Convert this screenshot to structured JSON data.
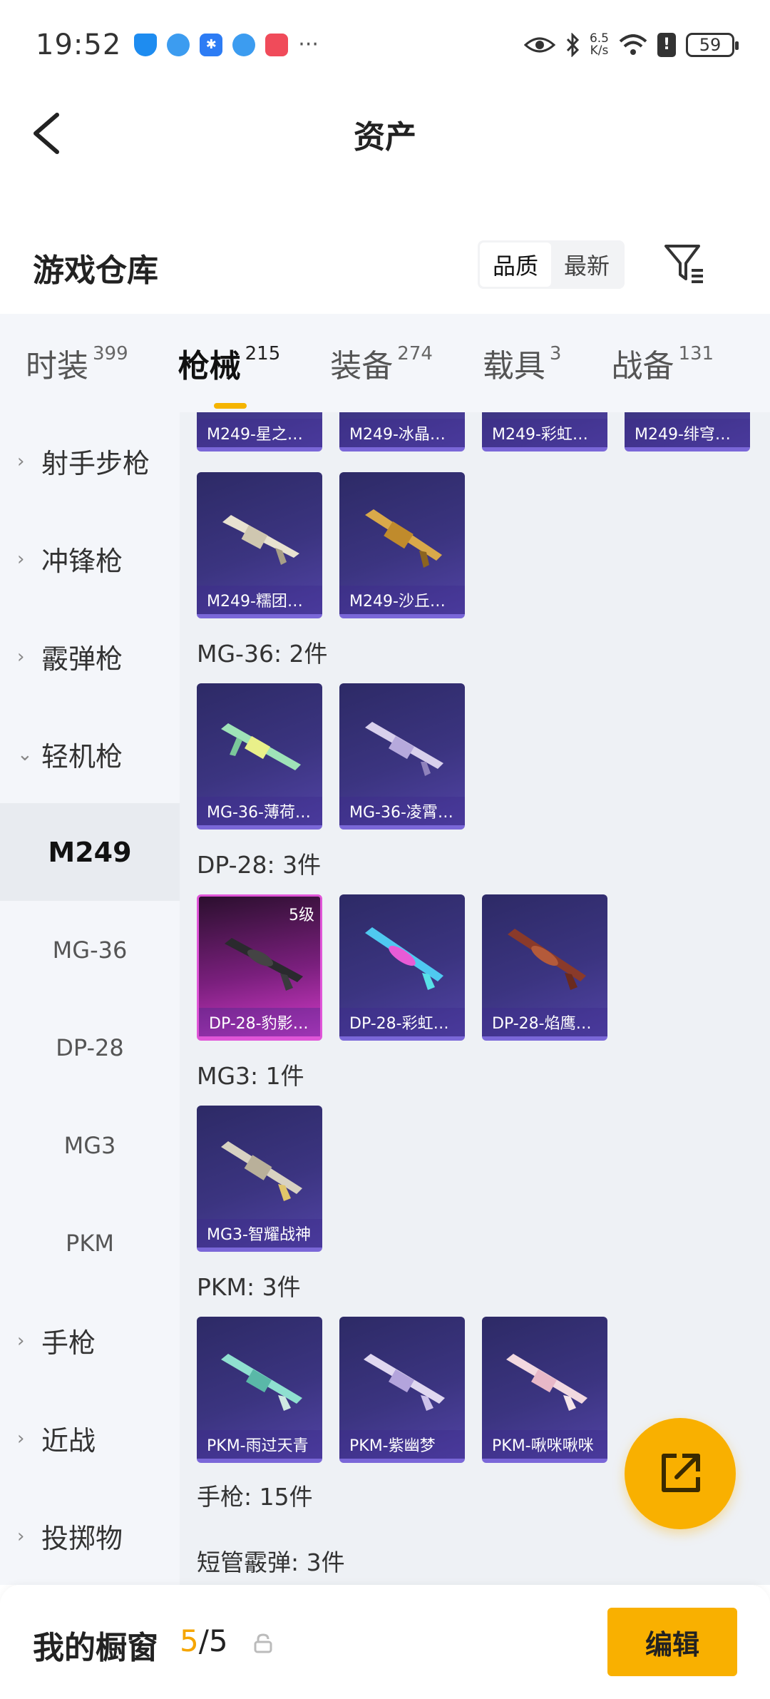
{
  "status": {
    "time": "19:52",
    "speed": "6.5",
    "speed_unit": "K/s",
    "battery": "59"
  },
  "header": {
    "title": "资产"
  },
  "warehouse": {
    "title": "游戏仓库",
    "sort_options": [
      "品质",
      "最新"
    ],
    "sort_active": "品质"
  },
  "tabs": [
    {
      "label": "时装",
      "count": "399"
    },
    {
      "label": "枪械",
      "count": "215"
    },
    {
      "label": "装备",
      "count": "274"
    },
    {
      "label": "载具",
      "count": "3"
    },
    {
      "label": "战备",
      "count": "131"
    }
  ],
  "sidebar": {
    "items": [
      "射手步枪",
      "冲锋枪",
      "霰弹枪",
      "轻机枪"
    ],
    "sub_items": [
      "M249",
      "MG-36",
      "DP-28",
      "MG3",
      "PKM"
    ],
    "items_after": [
      "手枪",
      "近战",
      "投掷物"
    ]
  },
  "content": {
    "top_cards": [
      "M249-星之…",
      "M249-冰晶…",
      "M249-彩虹…",
      "M249-绯穹…"
    ],
    "m249_cards": [
      "M249-糯团…",
      "M249-沙丘…"
    ],
    "groups": [
      {
        "label": "MG-36: 2件",
        "cards": [
          "MG-36-薄荷…",
          "MG-36-凌霄…"
        ]
      },
      {
        "label": "DP-28: 3件",
        "cards": [
          "DP-28-豹影…",
          "DP-28-彩虹…",
          "DP-28-焰鹰…"
        ],
        "level": "5级"
      },
      {
        "label": "MG3: 1件",
        "cards": [
          "MG3-智耀战神"
        ]
      },
      {
        "label": "PKM: 3件",
        "cards": [
          "PKM-雨过天青",
          "PKM-紫幽梦",
          "PKM-啾咪啾咪"
        ]
      }
    ],
    "more_labels": [
      "手枪: 15件",
      "短管霰弹: 3件"
    ]
  },
  "bottom": {
    "title": "我的橱窗",
    "current": "5",
    "total": "/5",
    "edit": "编辑"
  },
  "colors": {
    "accent": "#f9b000",
    "card_purple": "#3b3480",
    "card_pink": "#d33bc9"
  }
}
